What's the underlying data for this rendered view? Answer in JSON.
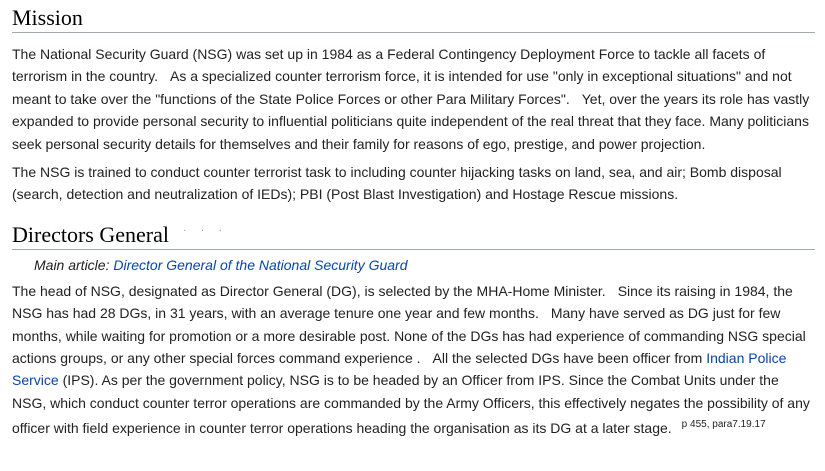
{
  "mission": {
    "heading": "Mission",
    "p1": {
      "s1": "The National Security Guard (NSG) was set up in 1984 as a Federal Contingency Deployment Force to tackle all facets of terrorism in the country.",
      "s2": "As a specialized counter terrorism force, it is intended for use \"only in exceptional situations\" and not meant to take over the \"functions of the State Police Forces or other Para Military Forces\".",
      "s3": "Yet, over the years its role has vastly expanded to provide personal security to influential politicians quite independent of the real threat that they face. Many politicians seek personal security details for themselves and their family for reasons of ego, prestige, and power projection."
    },
    "p2": "The NSG is trained to conduct counter terrorist task to including counter hijacking tasks on land, sea, and air; Bomb disposal (search, detection and neutralization of IEDs); PBI (Post Blast Investigation) and Hostage Rescue missions."
  },
  "directors": {
    "heading": "Directors General",
    "edit_hint": "· · ·",
    "hatnote_prefix": "Main article: ",
    "hatnote_link": "Director General of the National Security Guard",
    "p1": {
      "s1": "The head of NSG, designated as Director General (DG), is selected by the MHA-Home Minister.",
      "s2": "Since its raising in 1984, the NSG has had 28 DGs, in 31 years, with an average tenure one year and few months.",
      "s3": "Many have served as DG just for few months, while waiting for promotion or a more desirable post. None of the DGs has had experience of commanding NSG special actions groups, or any other special forces command experience .",
      "s4": "All the selected DGs have been officer from",
      "link": "Indian Police Service",
      "s5": "(IPS). As per the government policy, NSG is to be headed by an Officer from IPS. Since the Combat Units under the NSG, which conduct counter terror operations are commanded by the Army Officers, this effectively negates the possibility of any officer with field experience in counter terror operations heading the organisation as its DG at a later stage.",
      "ref": "p 455, para7.19.17"
    }
  }
}
